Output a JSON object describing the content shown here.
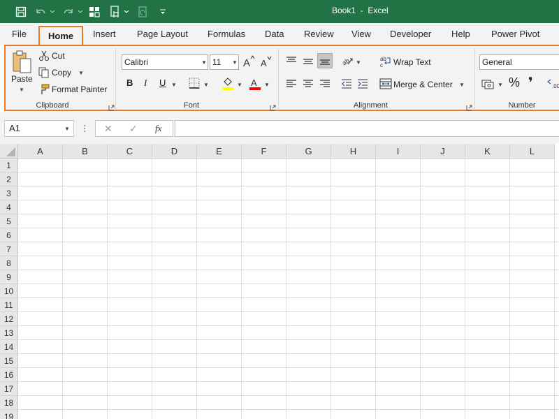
{
  "titlebar": {
    "title": "Book1  -  Excel",
    "bg_color": "#217346",
    "qat_icons": [
      "save-icon",
      "undo-icon",
      "redo-icon",
      "form-icon",
      "touch-mode-icon",
      "refresh-icon",
      "customize-qat-icon"
    ]
  },
  "tabs": [
    {
      "label": "File"
    },
    {
      "label": "Home"
    },
    {
      "label": "Insert"
    },
    {
      "label": "Page Layout"
    },
    {
      "label": "Formulas"
    },
    {
      "label": "Data"
    },
    {
      "label": "Review"
    },
    {
      "label": "View"
    },
    {
      "label": "Developer"
    },
    {
      "label": "Help"
    },
    {
      "label": "Power Pivot"
    }
  ],
  "ribbon": {
    "clipboard": {
      "paste_label": "Paste",
      "cut_label": "Cut",
      "copy_label": "Copy",
      "format_painter_label": "Format Painter",
      "group_label": "Clipboard"
    },
    "font": {
      "font_name": "Calibri",
      "font_size": "11",
      "bold": "B",
      "italic": "I",
      "underline": "U",
      "group_label": "Font",
      "highlight_color": "#ffff00",
      "font_color": "#ff0000"
    },
    "alignment": {
      "wrap_text_label": "Wrap Text",
      "merge_label": "Merge & Center",
      "group_label": "Alignment"
    },
    "number": {
      "format": "General",
      "percent": "%",
      "comma": "❜",
      "group_label": "Number"
    }
  },
  "formula_bar": {
    "name_box": "A1",
    "cancel": "✕",
    "enter": "✓",
    "fx": "fx",
    "value": ""
  },
  "grid": {
    "columns": [
      "A",
      "B",
      "C",
      "D",
      "E",
      "F",
      "G",
      "H",
      "I",
      "J",
      "K",
      "L"
    ],
    "rows": [
      "1",
      "2",
      "3",
      "4",
      "5",
      "6",
      "7",
      "8",
      "9",
      "10",
      "11",
      "12",
      "13",
      "14",
      "15",
      "16",
      "17",
      "18",
      "19"
    ]
  }
}
